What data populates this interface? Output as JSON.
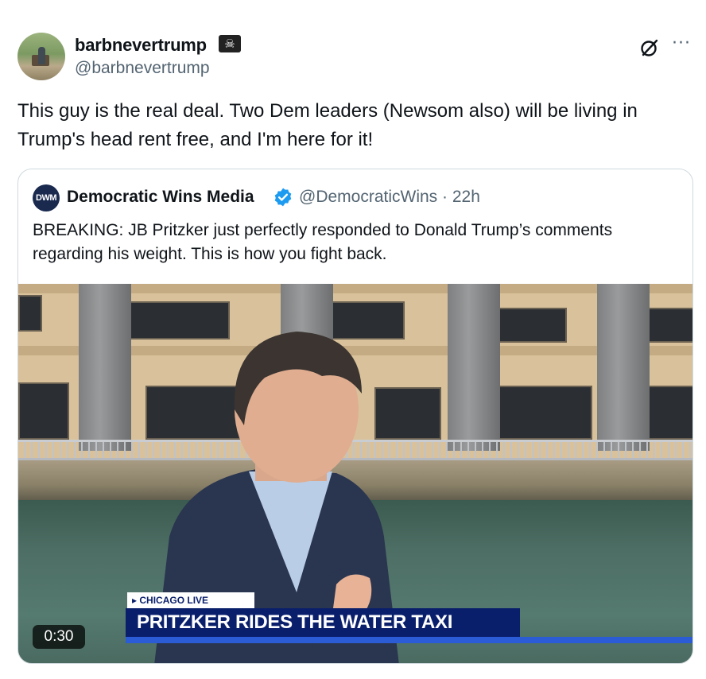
{
  "post": {
    "display_name": "barbnevertrump",
    "badge_icon": "skull-crossbones-icon",
    "handle": "@barbnevertrump",
    "text": "This guy is the real deal. Two Dem leaders (Newsom also) will be living in Trump's head rent free, and I'm here for it!"
  },
  "quoted": {
    "avatar_text": "DWM",
    "display_name": "Democratic Wins Media",
    "verified_icon": "verified-badge-icon",
    "handle_time": "@DemocraticWins · 22h",
    "text": "BREAKING: JB Pritzker just perfectly responded to Donald Trump’s comments regarding his weight. This is how you fight back.",
    "video": {
      "lower_third_small": "▸ CHICAGO LIVE",
      "lower_third_main": "PRITZKER RIDES THE WATER TAXI",
      "duration": "0:30"
    }
  },
  "colors": {
    "text_primary": "#0f1419",
    "text_secondary": "#536471",
    "border": "#cfd9de",
    "verified_blue": "#1d9bf0",
    "lower_third_navy": "#0a1f6b"
  }
}
